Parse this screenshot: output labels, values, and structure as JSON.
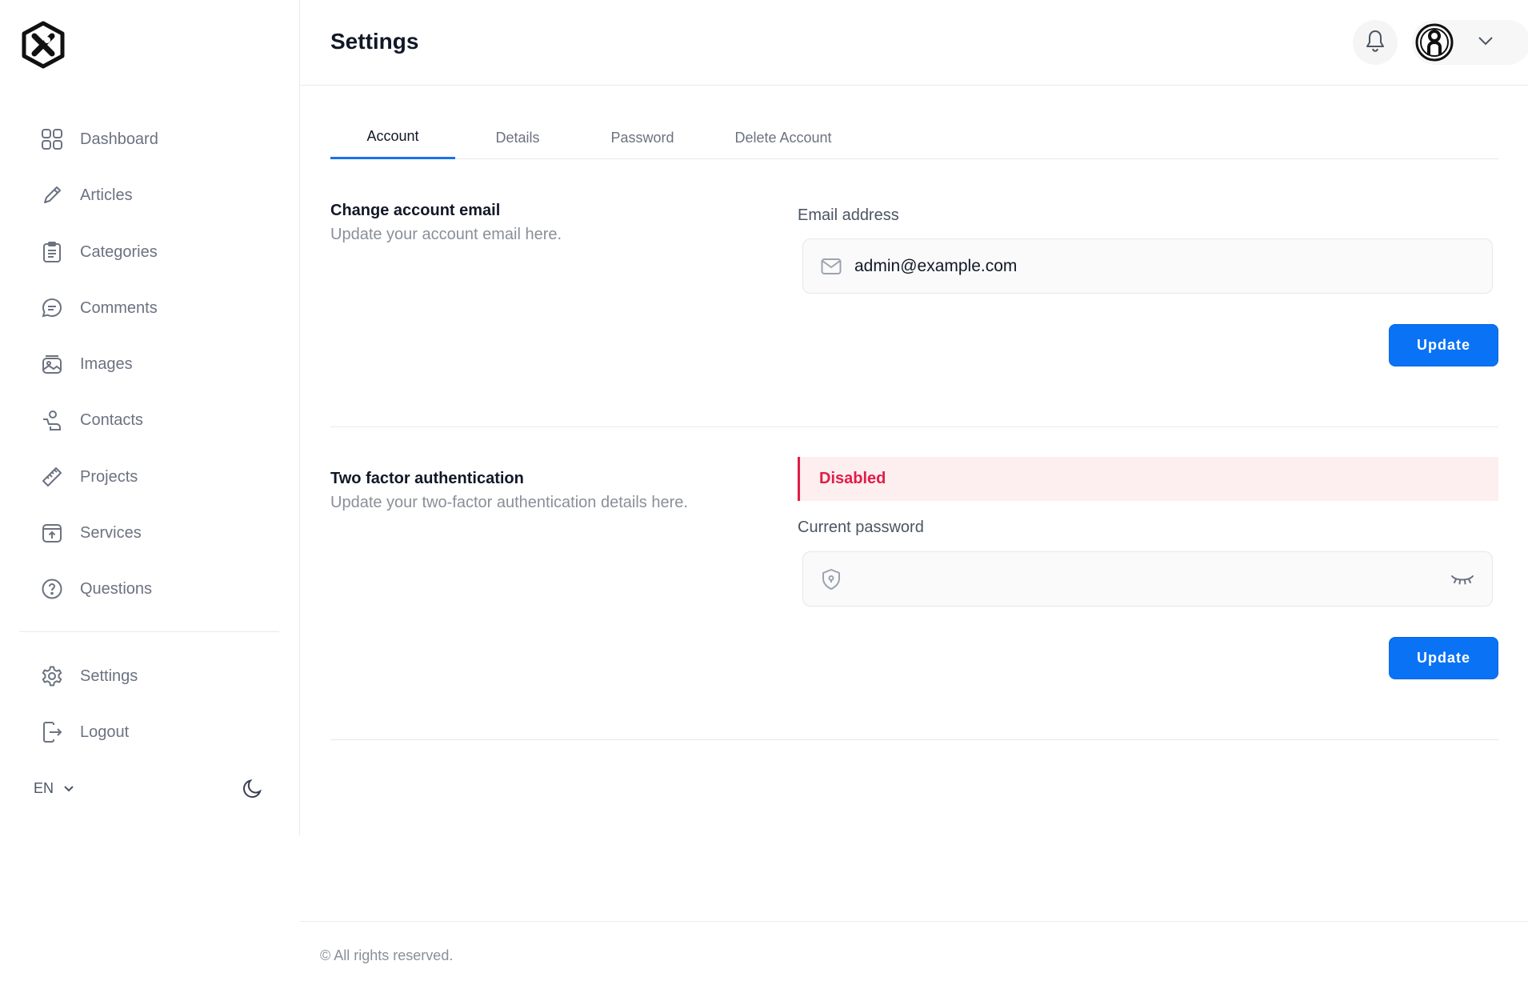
{
  "sidebar": {
    "items": [
      {
        "label": "Dashboard",
        "icon": "grid-icon"
      },
      {
        "label": "Articles",
        "icon": "pencil-icon"
      },
      {
        "label": "Categories",
        "icon": "clipboard-list-icon"
      },
      {
        "label": "Comments",
        "icon": "chat-bubble-icon"
      },
      {
        "label": "Images",
        "icon": "image-stack-icon"
      },
      {
        "label": "Contacts",
        "icon": "user-icon"
      },
      {
        "label": "Projects",
        "icon": "ruler-icon"
      },
      {
        "label": "Services",
        "icon": "upload-box-icon"
      },
      {
        "label": "Questions",
        "icon": "question-circle-icon"
      }
    ],
    "bottom_items": [
      {
        "label": "Settings",
        "icon": "gear-icon"
      },
      {
        "label": "Logout",
        "icon": "logout-icon"
      }
    ],
    "language": "EN"
  },
  "header": {
    "title": "Settings"
  },
  "tabs": [
    {
      "label": "Account",
      "active": true
    },
    {
      "label": "Details",
      "active": false
    },
    {
      "label": "Password",
      "active": false
    },
    {
      "label": "Delete Account",
      "active": false
    }
  ],
  "email_section": {
    "title": "Change account email",
    "description": "Update your account email here.",
    "field_label": "Email address",
    "email_value": "admin@example.com",
    "button": "Update"
  },
  "twofa_section": {
    "title": "Two factor authentication",
    "description": "Update your two-factor authentication details here.",
    "status": "Disabled",
    "field_label": "Current password",
    "password_value": "",
    "button": "Update"
  },
  "footer": {
    "text": "© All rights reserved."
  },
  "colors": {
    "accent": "#0a73f5",
    "danger": "#e11d48",
    "danger_bg": "#fdeef0"
  }
}
